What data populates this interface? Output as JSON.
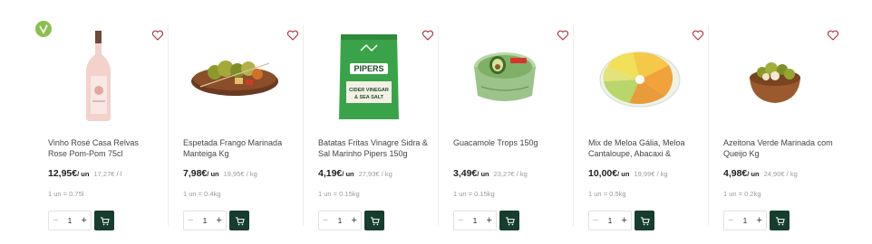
{
  "colors": {
    "accent": "#173d2f",
    "veggie": "#8cc04f",
    "muted": "#9a9a9a",
    "heart": "#b22e3e"
  },
  "products": [
    {
      "name": "Vinho Rosé Casa Relvas Rose Pom-Pom 75cl",
      "price": "12,95€",
      "price_unit": "/ un",
      "price_per": "17,27€ / l",
      "unit_info": "1 un = 0.75l",
      "qty": "1",
      "vegetarian": true,
      "image_icon": "rose-wine-bottle-icon"
    },
    {
      "name": "Espetada Frango Marinada Manteiga Kg",
      "price": "7,98€",
      "price_unit": "/ un",
      "price_per": "19,95€ / kg",
      "unit_info": "1 un = 0.4kg",
      "qty": "1",
      "vegetarian": false,
      "image_icon": "chicken-skewers-icon"
    },
    {
      "name": "Batatas Fritas Vinagre Sidra & Sal Marinho Pipers 150g",
      "price": "4,19€",
      "price_unit": "/ un",
      "price_per": "27,93€ / kg",
      "unit_info": "1 un = 0.15kg",
      "qty": "1",
      "vegetarian": false,
      "image_icon": "crisps-bag-icon",
      "package_text": [
        "PIPERS",
        "CIDER VINEGAR",
        "& SEA SALT"
      ]
    },
    {
      "name": "Guacamole Trops 150g",
      "price": "3,49€",
      "price_unit": "/ un",
      "price_per": "23,27€ / kg",
      "unit_info": "1 un = 0.15kg",
      "qty": "1",
      "vegetarian": false,
      "image_icon": "guacamole-tub-icon"
    },
    {
      "name": "Mix de Meloa Gália, Meloa Cantaloupe, Abacaxi &",
      "price": "10,00€",
      "price_unit": "/ un",
      "price_per": "19,99€ / kg",
      "unit_info": "1 un = 0.5kg",
      "qty": "1",
      "vegetarian": false,
      "image_icon": "fruit-mix-tray-icon"
    },
    {
      "name": "Azeitona Verde Marinada com Queijo Kg",
      "price": "4,98€",
      "price_unit": "/ un",
      "price_per": "24,90€ / kg",
      "unit_info": "1 un = 0.2kg",
      "qty": "1",
      "vegetarian": false,
      "image_icon": "olives-bowl-icon"
    }
  ]
}
